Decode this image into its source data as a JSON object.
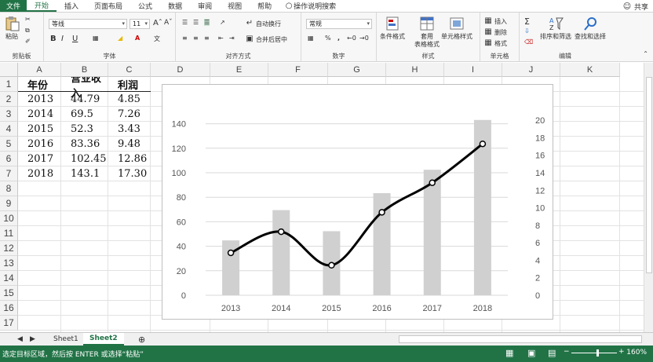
{
  "menu": {
    "file": "文件",
    "tabs": [
      "开始",
      "插入",
      "页面布局",
      "公式",
      "数据",
      "审阅",
      "视图",
      "帮助"
    ],
    "tell_me": "操作说明搜索",
    "share": "共享"
  },
  "ribbon": {
    "clipboard": {
      "paste": "粘贴",
      "label": "剪贴板"
    },
    "font": {
      "name": "等线",
      "size": "11",
      "label": "字体",
      "bold": "B",
      "italic": "I",
      "underline": "U"
    },
    "alignment": {
      "wrap": "自动换行",
      "merge": "合并后居中",
      "label": "对齐方式"
    },
    "number": {
      "format": "常规",
      "label": "数字",
      "percent": "%"
    },
    "styles": {
      "conditional": "条件格式",
      "table_line1": "套用",
      "table_line2": "表格格式",
      "cell_styles": "单元格样式",
      "label": "样式"
    },
    "cells": {
      "insert": "插入",
      "delete": "删除",
      "format": "格式",
      "label": "单元格"
    },
    "editing": {
      "sort": "排序和筛选",
      "find": "查找和选择",
      "label": "编辑"
    }
  },
  "columns": [
    "A",
    "B",
    "C",
    "D",
    "E",
    "F",
    "G",
    "H",
    "I",
    "J",
    "K"
  ],
  "rows": [
    "1",
    "2",
    "3",
    "4",
    "5",
    "6",
    "7",
    "8",
    "9",
    "10",
    "11",
    "12",
    "13",
    "14",
    "15",
    "16",
    "17"
  ],
  "table": {
    "headers": [
      "年份",
      "营业收入",
      "利润"
    ],
    "data": [
      [
        "2013",
        "44.79",
        "4.85"
      ],
      [
        "2014",
        "69.5",
        "7.26"
      ],
      [
        "2015",
        "52.3",
        "3.43"
      ],
      [
        "2016",
        "83.36",
        "9.48"
      ],
      [
        "2017",
        "102.45",
        "12.86"
      ],
      [
        "2018",
        "143.1",
        "17.30"
      ]
    ]
  },
  "chart_data": {
    "type": "bar",
    "categories": [
      "2013",
      "2014",
      "2015",
      "2016",
      "2017",
      "2018"
    ],
    "series": [
      {
        "type": "bar",
        "axis": "primary",
        "values": [
          44.79,
          69.5,
          52.3,
          83.36,
          102.45,
          143.1
        ],
        "color": "#d0d0d0"
      },
      {
        "type": "line",
        "axis": "secondary",
        "smooth": true,
        "values": [
          4.85,
          7.26,
          3.43,
          9.48,
          12.86,
          17.3
        ],
        "color": "#000000"
      }
    ],
    "ylim": [
      0,
      150
    ],
    "y_ticks": [
      "0",
      "20",
      "40",
      "60",
      "80",
      "100",
      "120",
      "140"
    ],
    "y2lim": [
      0,
      21
    ],
    "y2_ticks": [
      "0",
      "2",
      "4",
      "6",
      "8",
      "10",
      "12",
      "14",
      "16",
      "18",
      "20"
    ],
    "grid": true
  },
  "sheets": [
    "Sheet1",
    "Sheet2"
  ],
  "active_sheet": "Sheet2",
  "status": {
    "message": "选定目标区域，然后按 ENTER 或选择“粘贴”",
    "zoom": "160%"
  }
}
